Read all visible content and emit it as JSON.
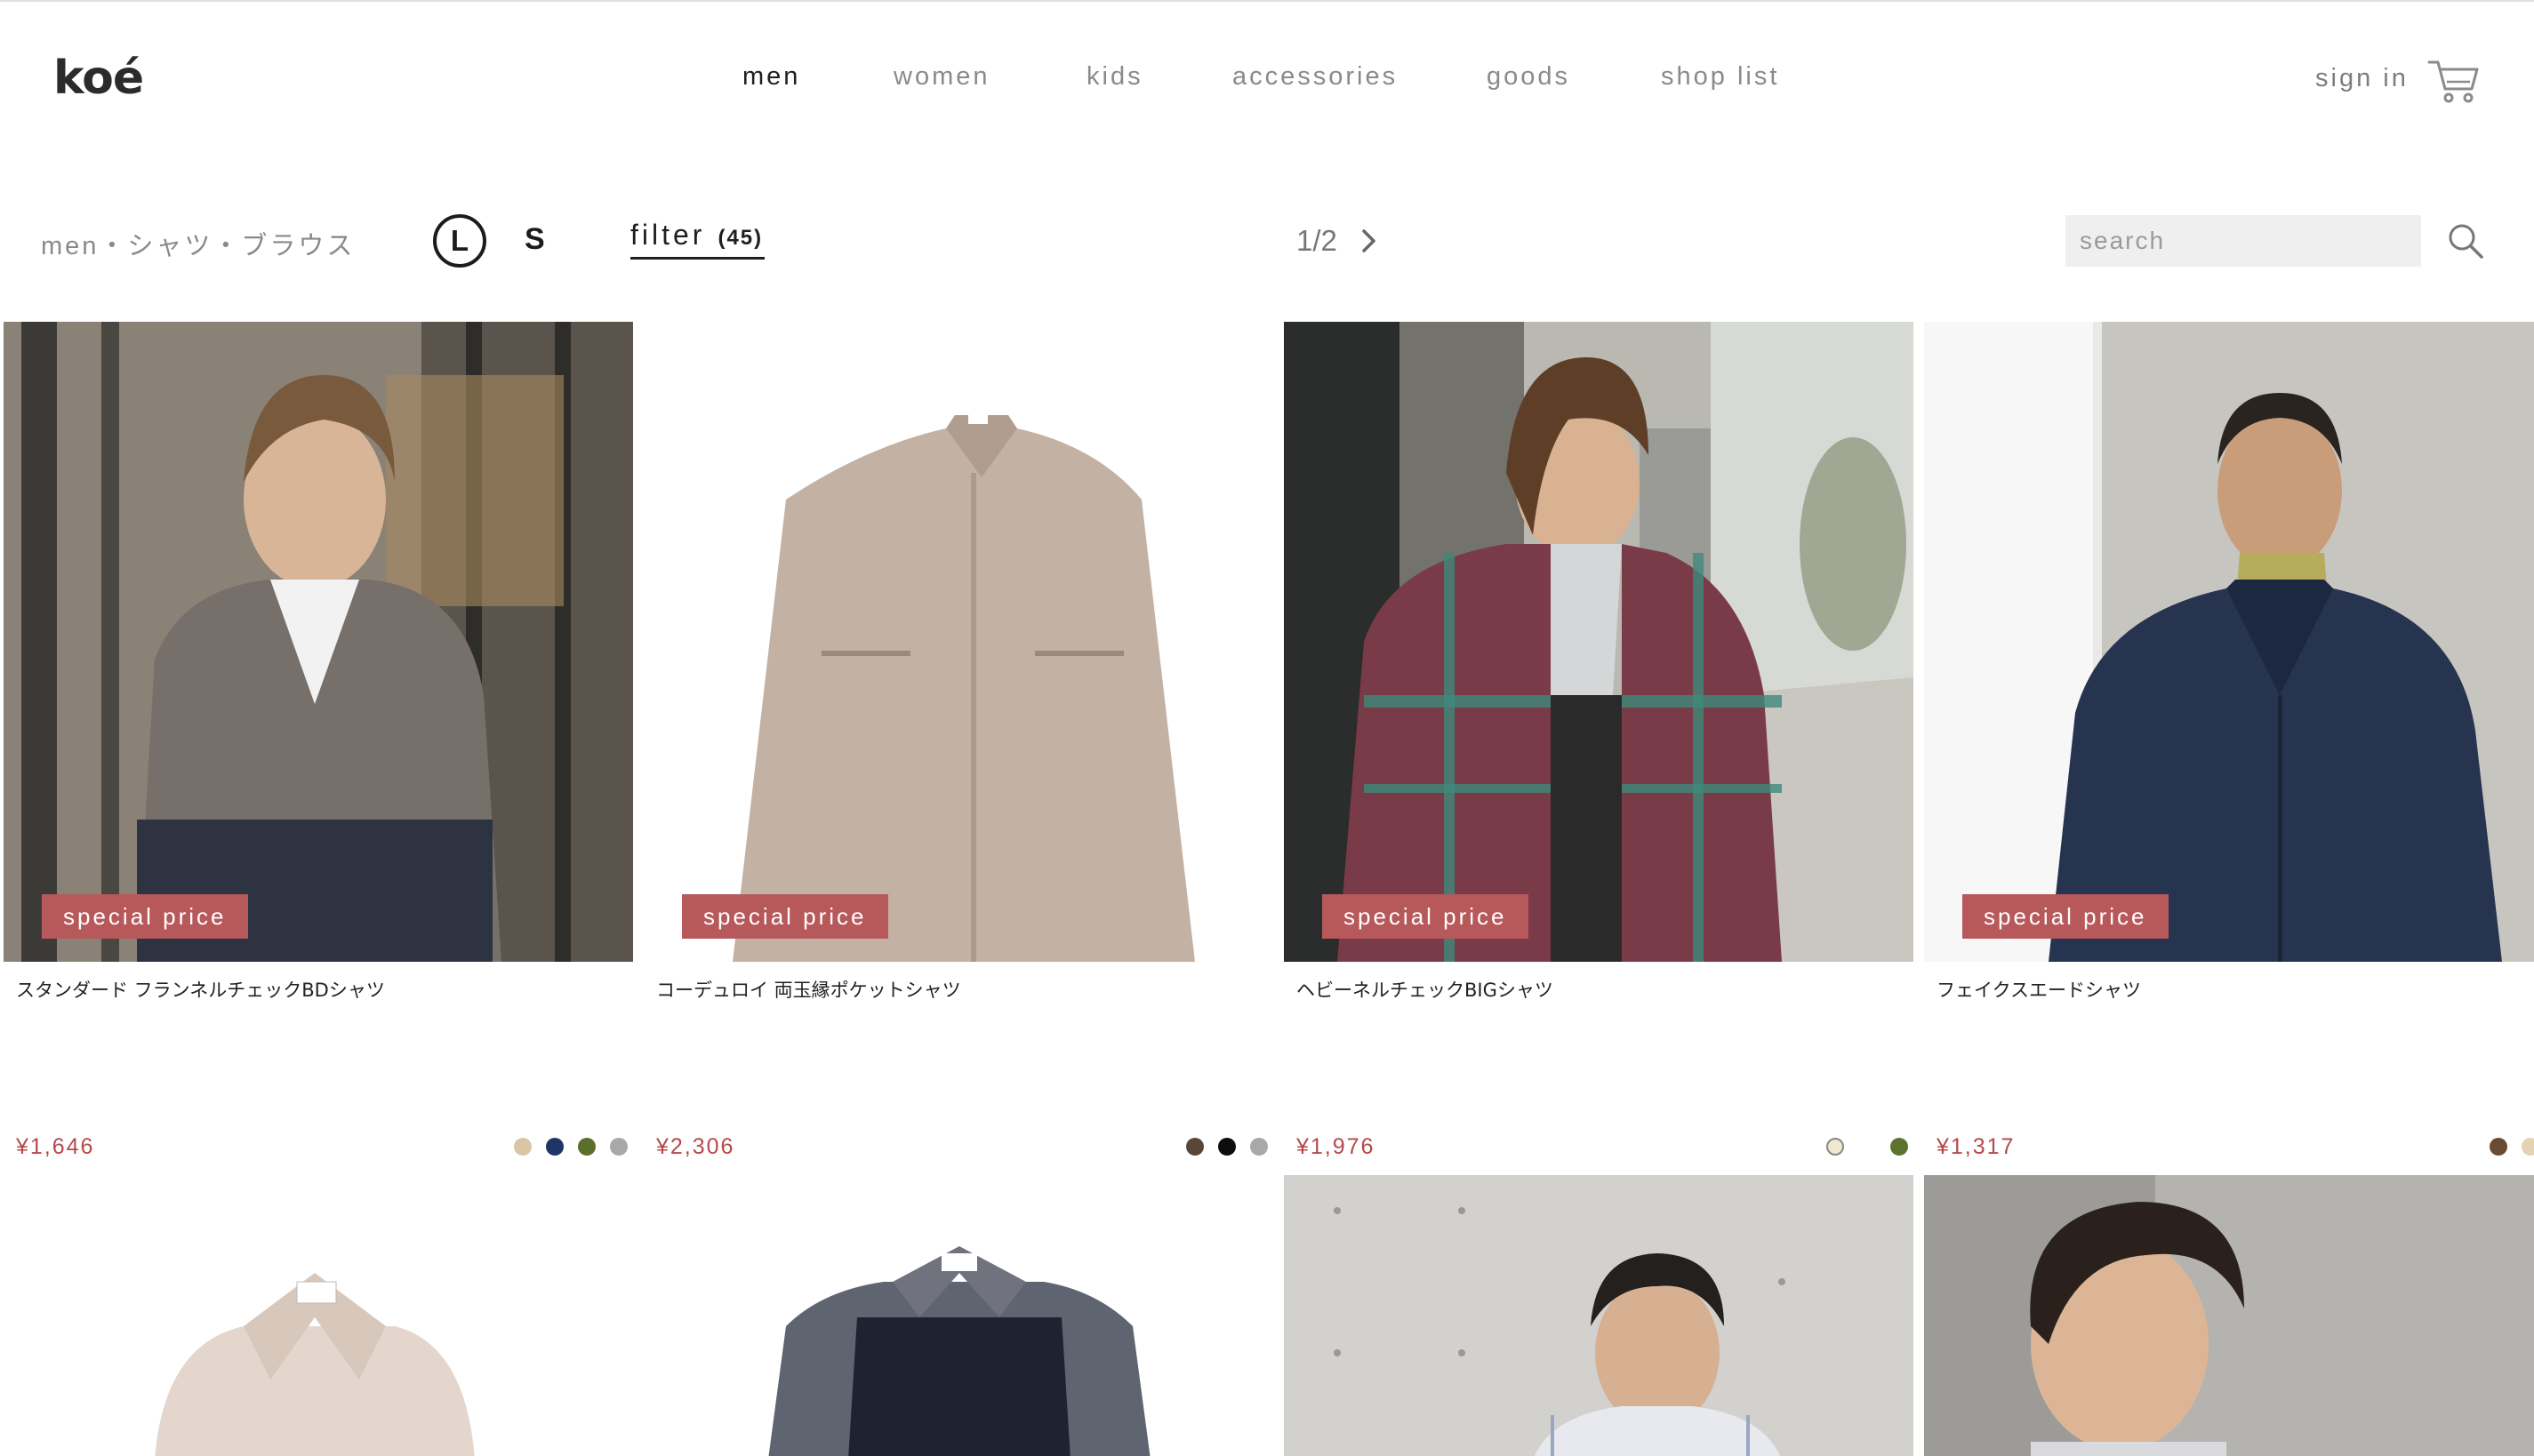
{
  "brand": {
    "logo": "koé"
  },
  "nav": {
    "items": [
      {
        "label": "men",
        "active": true
      },
      {
        "label": "women",
        "active": false
      },
      {
        "label": "kids",
        "active": false
      },
      {
        "label": "accessories",
        "active": false
      },
      {
        "label": "goods",
        "active": false
      },
      {
        "label": "shop list",
        "active": false
      }
    ],
    "signin": "sign in",
    "cart_icon": "cart-icon"
  },
  "toolbar": {
    "breadcrumb": "men・シャツ・ブラウス",
    "size_l": "L",
    "size_s": "S",
    "filter_label": "filter",
    "filter_count": "(45)",
    "pagination": "1/2",
    "search_placeholder": "search"
  },
  "colors": {
    "badge": "#b7585b",
    "price": "#b5484b",
    "accent": "#1f1f1f"
  },
  "products": [
    {
      "name": "スタンダード フランネルチェックBDシャツ",
      "price": "¥1,646",
      "badge": "special price",
      "swatches": [
        "#d9c6a5",
        "#1f3566",
        "#5b6e2c",
        "#a8a8a8"
      ]
    },
    {
      "name": "コーデュロイ 両玉縁ポケットシャツ",
      "price": "¥2,306",
      "badge": "special price",
      "swatches": [
        "#5a4636",
        "#0d0d0d",
        "#a8a8a8"
      ]
    },
    {
      "name": "ヘビーネルチェックBIGシャツ",
      "price": "¥1,976",
      "badge": "special price",
      "swatches": [
        "#f1e7cf",
        "#ffffff",
        "#5d7430"
      ]
    },
    {
      "name": "フェイクスエードシャツ",
      "price": "¥1,317",
      "badge": "special price",
      "swatches": [
        "#6b4a33",
        "#e3d3b3",
        "#1e3868"
      ]
    }
  ]
}
